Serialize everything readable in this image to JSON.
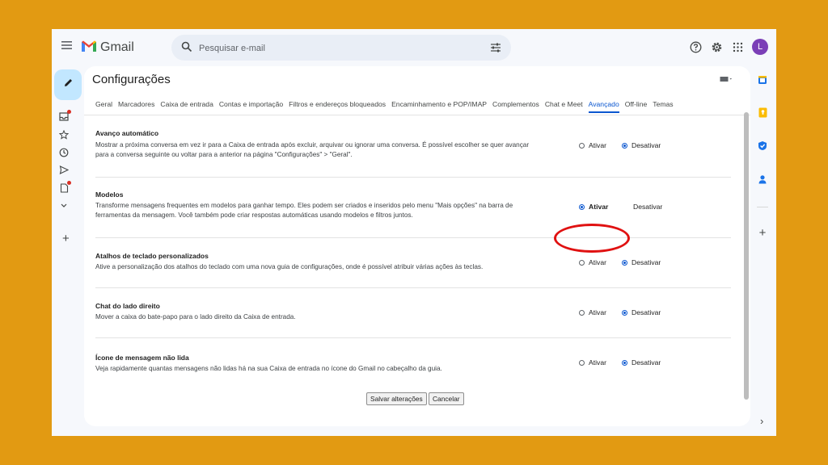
{
  "app": {
    "name": "Gmail",
    "avatar_letter": "L"
  },
  "search": {
    "placeholder": "Pesquisar e-mail"
  },
  "icons": {
    "menu": "menu-icon",
    "search": "search-icon",
    "tune": "tune-icon",
    "help": "help-icon",
    "settings": "gear-icon",
    "apps": "apps-grid-icon",
    "compose": "pencil-icon",
    "inbox": "inbox-icon",
    "starred": "star-icon",
    "snoozed": "clock-icon",
    "sent": "send-icon",
    "drafts": "draft-icon",
    "more": "chevron-down-icon",
    "new_label": "plus-icon"
  },
  "colors": {
    "accent": "#0B57D0",
    "highlight": "#E01111",
    "frame": "#E29A12"
  },
  "settings": {
    "title": "Configurações",
    "tabs": [
      "Geral",
      "Marcadores",
      "Caixa de entrada",
      "Contas e importação",
      "Filtros e endereços bloqueados",
      "Encaminhamento e POP/IMAP",
      "Complementos",
      "Chat e Meet",
      "Avançado",
      "Off-line",
      "Temas"
    ],
    "active_tab": "Avançado",
    "option_on": "Ativar",
    "option_off": "Desativar",
    "sections": [
      {
        "title": "Avanço automático",
        "description": "Mostrar a próxima conversa em vez ir para a Caixa de entrada após excluir, arquivar ou ignorar uma conversa. É possível escolher se quer avançar para a conversa seguinte ou voltar para a anterior na página \"Configurações\" > \"Geral\".",
        "selected": "Desativar"
      },
      {
        "title": "Modelos",
        "description": "Transforme mensagens frequentes em modelos para ganhar tempo. Eles podem ser criados e inseridos pelo menu \"Mais opções\" na barra de ferramentas da mensagem. Você também pode criar respostas automáticas usando modelos e filtros juntos.",
        "selected": "Ativar"
      },
      {
        "title": "Atalhos de teclado personalizados",
        "description": "Ative a personalização dos atalhos do teclado com uma nova guia de configurações, onde é possível atribuir várias ações às teclas.",
        "selected": "Desativar"
      },
      {
        "title": "Chat do lado direito",
        "description": "Mover a caixa do bate-papo para o lado direito da Caixa de entrada.",
        "selected": "Desativar"
      },
      {
        "title": "Ícone de mensagem não lida",
        "description": "Veja rapidamente quantas mensagens não lidas há na sua Caixa de entrada no ícone do Gmail no cabeçalho da guia.",
        "selected": "Desativar"
      }
    ],
    "save_label": "Salvar alterações",
    "cancel_label": "Cancelar"
  }
}
